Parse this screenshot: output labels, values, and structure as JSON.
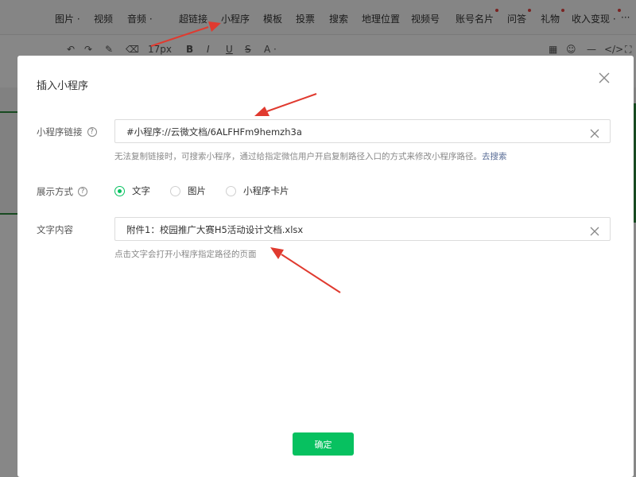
{
  "toolbar": {
    "menu": [
      {
        "label": "图片 ·",
        "badge": false
      },
      {
        "label": "视频",
        "badge": false
      },
      {
        "label": "音频 ·",
        "badge": false
      },
      {
        "label": "超链接",
        "badge": false
      },
      {
        "label": "小程序",
        "badge": false
      },
      {
        "label": "模板",
        "badge": false
      },
      {
        "label": "投票",
        "badge": false
      },
      {
        "label": "搜索",
        "badge": false
      },
      {
        "label": "地理位置",
        "badge": false
      },
      {
        "label": "视频号",
        "badge": false
      },
      {
        "label": "账号名片",
        "badge": true
      },
      {
        "label": "问答",
        "badge": true
      },
      {
        "label": "礼物",
        "badge": true
      },
      {
        "label": "收入变现 ·",
        "badge": true
      },
      {
        "label": "···",
        "badge": false
      }
    ],
    "font_size": "17px",
    "format_buttons": [
      "B",
      "I",
      "U",
      "S",
      "A ·"
    ]
  },
  "dialog": {
    "title": "插入小程序",
    "link": {
      "label": "小程序链接",
      "help": "?",
      "value": "#小程序://云微文档/6ALFHFm9hemzh3a",
      "hint": "无法复制链接时，可搜索小程序，通过给指定微信用户开启复制路径入口的方式来修改小程序路径。",
      "hint_link": "去搜索"
    },
    "display": {
      "label": "展示方式",
      "help": "?",
      "options": [
        {
          "label": "文字",
          "selected": true
        },
        {
          "label": "图片",
          "selected": false
        },
        {
          "label": "小程序卡片",
          "selected": false
        }
      ]
    },
    "text": {
      "label": "文字内容",
      "value": "附件1：校园推广大赛H5活动设计文档.xlsx",
      "hint": "点击文字会打开小程序指定路径的页面"
    },
    "confirm_label": "确定"
  },
  "colors": {
    "accent": "#07c160",
    "annotation_arrow": "#e03a2f",
    "link": "#576b95"
  }
}
